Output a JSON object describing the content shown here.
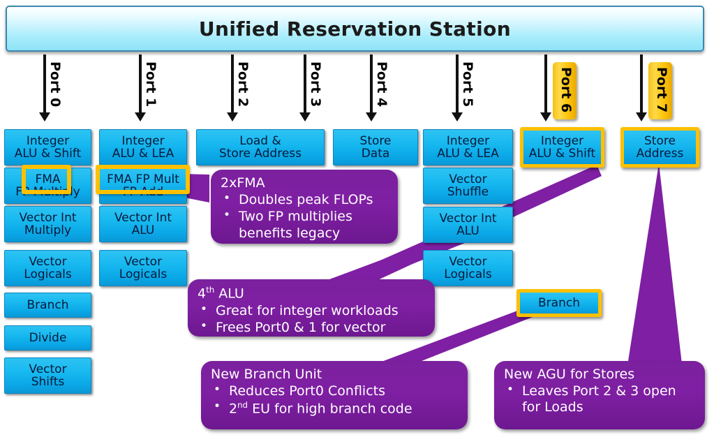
{
  "header": {
    "title": "Unified Reservation Station"
  },
  "ports": [
    {
      "id": "port0",
      "label": "Port 0",
      "highlight": false
    },
    {
      "id": "port1",
      "label": "Port 1",
      "highlight": false
    },
    {
      "id": "port2",
      "label": "Port 2",
      "highlight": false
    },
    {
      "id": "port3",
      "label": "Port 3",
      "highlight": false
    },
    {
      "id": "port4",
      "label": "Port 4",
      "highlight": false
    },
    {
      "id": "port5",
      "label": "Port 5",
      "highlight": false
    },
    {
      "id": "port6",
      "label": "Port 6",
      "highlight": true
    },
    {
      "id": "port7",
      "label": "Port 7",
      "highlight": true
    }
  ],
  "columns": {
    "port0": {
      "units": [
        {
          "lines": [
            "Integer",
            "ALU & Shift"
          ]
        },
        {
          "lines": [
            "FMA",
            "FP Multiply"
          ]
        },
        {
          "lines": [
            "Vector Int",
            "Multiply"
          ]
        },
        {
          "lines": [
            "Vector",
            "Logicals"
          ]
        },
        {
          "lines": [
            "Branch"
          ]
        },
        {
          "lines": [
            "Divide"
          ]
        },
        {
          "lines": [
            "Vector",
            "Shifts"
          ]
        }
      ]
    },
    "port1": {
      "units": [
        {
          "lines": [
            "Integer",
            "ALU & LEA"
          ]
        },
        {
          "lines": [
            "FMA FP Mult",
            "FP Add"
          ]
        },
        {
          "lines": [
            "Vector Int",
            "ALU"
          ]
        },
        {
          "lines": [
            "Vector",
            "Logicals"
          ]
        }
      ]
    },
    "port23": {
      "units": [
        {
          "lines": [
            "Load &",
            "Store Address"
          ]
        }
      ]
    },
    "port4": {
      "units": [
        {
          "lines": [
            "Store",
            "Data"
          ]
        }
      ]
    },
    "port5": {
      "units": [
        {
          "lines": [
            "Integer",
            "ALU & LEA"
          ]
        },
        {
          "lines": [
            "Vector",
            "Shuffle"
          ]
        },
        {
          "lines": [
            "Vector Int",
            "ALU"
          ]
        },
        {
          "lines": [
            "Vector",
            "Logicals"
          ]
        }
      ]
    },
    "port6": {
      "units": [
        {
          "lines": [
            "Integer",
            "ALU & Shift"
          ],
          "highlight": true
        },
        {
          "lines": [
            "Branch"
          ],
          "highlight": true
        }
      ]
    },
    "port7": {
      "units": [
        {
          "lines": [
            "Store",
            "Address"
          ],
          "highlight": true
        }
      ]
    }
  },
  "highlight_frames": [
    {
      "id": "fma-frame-port0",
      "label": "FMA"
    },
    {
      "id": "fma-frame-port1",
      "label": "FMA FP Mult"
    }
  ],
  "callouts": [
    {
      "id": "callout-2xfma",
      "title": "2xFMA",
      "title_sup": "",
      "bullets": [
        "Doubles peak FLOPs",
        "Two FP multiplies benefits legacy"
      ]
    },
    {
      "id": "callout-4th-alu",
      "title": "4",
      "title_sup": "th",
      "title_rest": " ALU",
      "bullets": [
        "Great for integer workloads",
        "Frees Port0 & 1 for vector"
      ]
    },
    {
      "id": "callout-new-branch-unit",
      "title": "New Branch Unit",
      "title_sup": "",
      "bullets": [
        "Reduces Port0 Conflicts",
        "2nd EU for high branch code"
      ],
      "bullet2_pre": "2",
      "bullet2_sup": "nd",
      "bullet2_rest": " EU for high branch code"
    },
    {
      "id": "callout-new-agu",
      "title": "New AGU for Stores",
      "title_sup": "",
      "bullets": [
        "Leaves Port 2 & 3 open for Loads"
      ]
    }
  ],
  "colors": {
    "header_border": "#3b87b0",
    "header_fill_top": "#ffffff",
    "header_fill_bottom": "#8fe3f7",
    "unit_fill": "#18b9f0",
    "unit_text": "#071a3a",
    "highlight_gold": "#ffc000",
    "callout_purple": "#7f1fa3",
    "arrow_black": "#111111",
    "background": "#ffffff"
  }
}
